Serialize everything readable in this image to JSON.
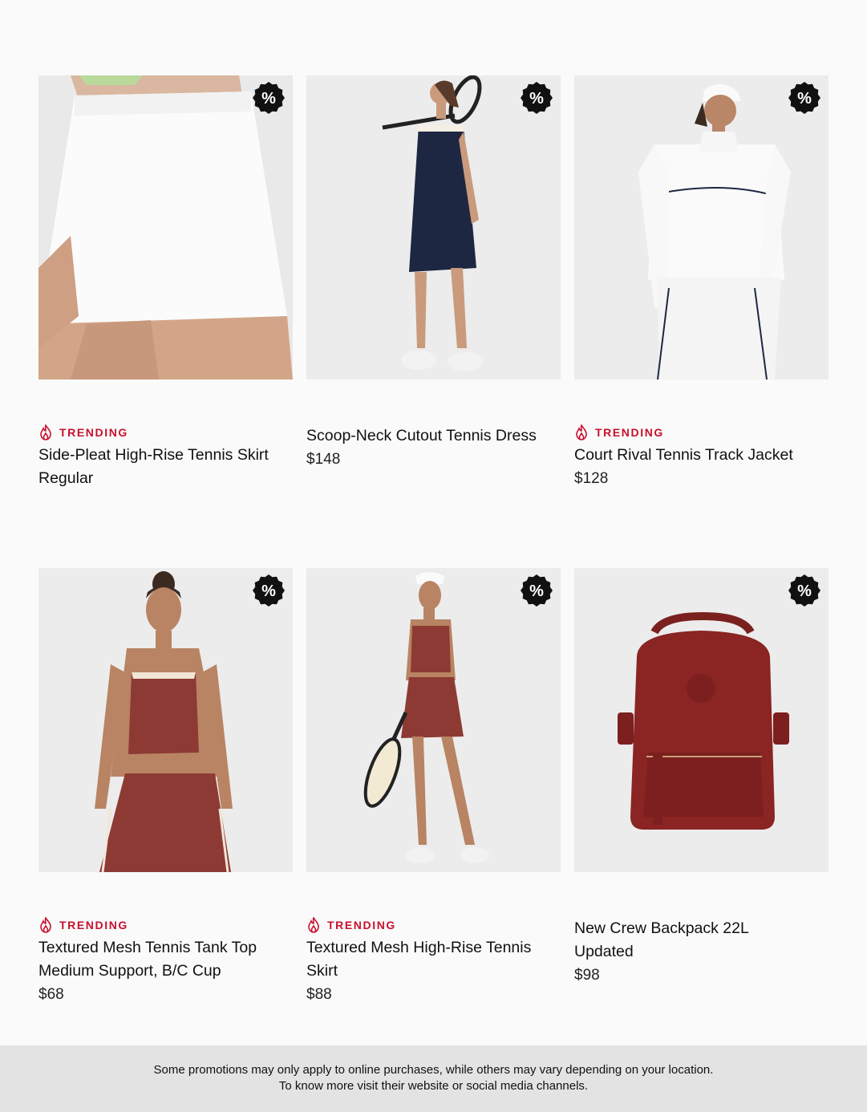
{
  "products": [
    {
      "trending": true,
      "tag": "TRENDING",
      "name": "Side-Pleat High-Rise Tennis Skirt",
      "variant": "Regular",
      "price": "",
      "image": "white-pleated-skirt-photo",
      "badge": "%"
    },
    {
      "trending": false,
      "tag": "",
      "name": "Scoop-Neck Cutout Tennis Dress",
      "variant": "",
      "price": "$148",
      "image": "navy-tennis-dress-photo",
      "badge": "%"
    },
    {
      "trending": true,
      "tag": "TRENDING",
      "name": "Court Rival Tennis Track Jacket",
      "variant": "",
      "price": "$128",
      "image": "white-track-jacket-photo",
      "badge": "%"
    },
    {
      "trending": true,
      "tag": "TRENDING",
      "name": "Textured Mesh Tennis Tank Top",
      "variant": "Medium Support, B/C Cup",
      "price": "$68",
      "image": "red-mesh-tank-photo",
      "badge": "%"
    },
    {
      "trending": true,
      "tag": "TRENDING",
      "name": "Textured Mesh High-Rise Tennis",
      "variant": "Skirt",
      "price": "$88",
      "image": "red-mesh-skirt-photo",
      "badge": "%"
    },
    {
      "trending": false,
      "tag": "",
      "name": "New Crew Backpack 22L",
      "variant": "Updated",
      "price": "$98",
      "image": "red-backpack-photo",
      "badge": "%"
    }
  ],
  "colors": {
    "trending": "#c8102e",
    "badge": "#111111",
    "footer_bg": "#e3e3e3"
  },
  "footer": {
    "line1": "Some promotions may only apply to online purchases, while others may vary depending on your location.",
    "line2": "To know more visit their website or social media channels."
  }
}
